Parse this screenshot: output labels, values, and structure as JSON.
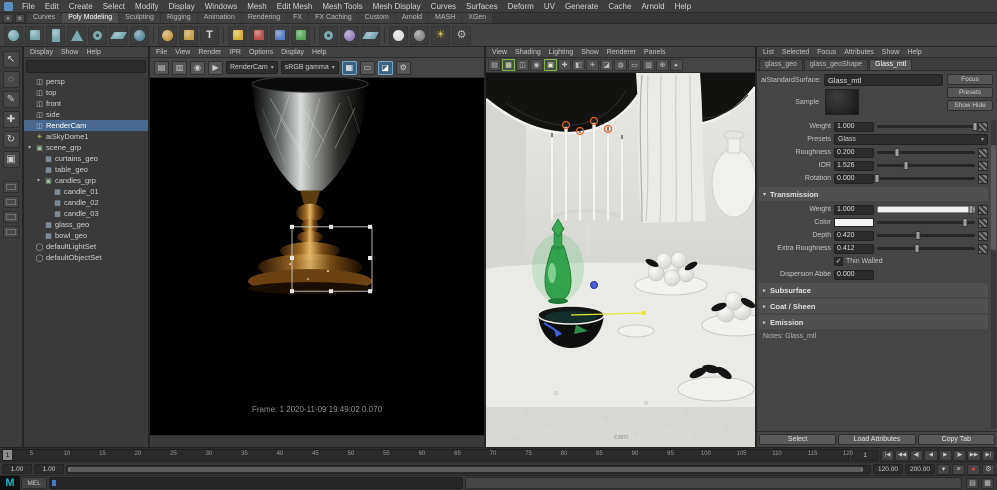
{
  "menu_bar": {
    "items": [
      "File",
      "Edit",
      "Create",
      "Select",
      "Modify",
      "Display",
      "Windows",
      "Mesh",
      "Edit Mesh",
      "Mesh Tools",
      "Mesh Display",
      "Curves",
      "Surfaces",
      "Deform",
      "UV",
      "Generate",
      "Cache",
      "Arnold",
      "Help"
    ]
  },
  "shelf": {
    "tabs": [
      "Curves",
      "Poly Modeling",
      "Sculpting",
      "Rigging",
      "Animation",
      "Rendering",
      "FX",
      "FX Caching",
      "Custom",
      "Arnold",
      "MASH",
      "XGen"
    ],
    "active_tab": "Poly Modeling",
    "icons": [
      {
        "name": "poly-sphere",
        "shape": "circle",
        "color": "#79aab2"
      },
      {
        "name": "poly-cube",
        "shape": "square",
        "color": "#79aab2"
      },
      {
        "name": "poly-cylinder",
        "shape": "rect",
        "color": "#79aab2"
      },
      {
        "name": "poly-cone",
        "shape": "triangle",
        "color": "#79aab2"
      },
      {
        "name": "poly-torus",
        "shape": "ring",
        "color": "#79aab2"
      },
      {
        "name": "poly-plane",
        "shape": "plane",
        "color": "#79aab2"
      },
      {
        "name": "poly-disc",
        "shape": "circle",
        "color": "#5d8fa0"
      },
      {
        "name": "sep1",
        "shape": "sep"
      },
      {
        "name": "nurbs-sphere",
        "shape": "circle",
        "color": "#c9a04e"
      },
      {
        "name": "nurbs-cube",
        "shape": "square",
        "color": "#c9a04e"
      },
      {
        "name": "text-tool",
        "shape": "letter",
        "label": "T",
        "color": "#d8d8d8"
      },
      {
        "name": "sep2",
        "shape": "sep"
      },
      {
        "name": "quad-draw",
        "shape": "square",
        "color": "#d8b23e"
      },
      {
        "name": "multi-cut",
        "shape": "square",
        "color": "#b8524a"
      },
      {
        "name": "target-weld",
        "shape": "square",
        "color": "#5a7fc0"
      },
      {
        "name": "bridge",
        "shape": "square",
        "color": "#58a858"
      },
      {
        "name": "sep3",
        "shape": "sep"
      },
      {
        "name": "booleans",
        "shape": "ring",
        "color": "#79aab2"
      },
      {
        "name": "smooth",
        "shape": "circle",
        "color": "#9a86c0"
      },
      {
        "name": "mirror",
        "shape": "plane",
        "color": "#79aab2"
      },
      {
        "name": "sep4",
        "shape": "sep"
      },
      {
        "name": "arnold-render",
        "shape": "circle",
        "color": "#e0e0e0"
      },
      {
        "name": "arnold-ipr",
        "shape": "circle",
        "color": "#8a8a8a"
      },
      {
        "name": "skydome-light",
        "shape": "glyph",
        "glyph": "☀",
        "color": "#d8c050"
      },
      {
        "name": "render-settings",
        "shape": "glyph",
        "glyph": "⚙",
        "color": "#bbbbbb"
      }
    ]
  },
  "toolbox": {
    "tools": [
      {
        "name": "select-tool",
        "glyph": "↖"
      },
      {
        "name": "lasso-tool",
        "glyph": "◌"
      },
      {
        "name": "paint-select-tool",
        "glyph": "✎"
      },
      {
        "name": "move-tool",
        "glyph": "✚"
      },
      {
        "name": "rotate-tool",
        "glyph": "↻"
      },
      {
        "name": "scale-tool",
        "glyph": "▣"
      }
    ],
    "layouts": [
      {
        "name": "layout-single"
      },
      {
        "name": "layout-four"
      },
      {
        "name": "layout-two"
      },
      {
        "name": "layout-outliner"
      }
    ]
  },
  "outliner": {
    "menus": [
      "Display",
      "Show",
      "Help"
    ],
    "search_placeholder": "",
    "items": [
      {
        "label": "persp",
        "icon": "camera",
        "depth": 1
      },
      {
        "label": "top",
        "icon": "camera",
        "depth": 1
      },
      {
        "label": "front",
        "icon": "camera",
        "depth": 1
      },
      {
        "label": "side",
        "icon": "camera",
        "depth": 1
      },
      {
        "label": "RenderCam",
        "icon": "camera",
        "depth": 1,
        "selected": true
      },
      {
        "label": "aiSkyDome1",
        "icon": "light",
        "depth": 1
      },
      {
        "label": "scene_grp",
        "icon": "group",
        "depth": 1,
        "expanded": true
      },
      {
        "label": "curtains_geo",
        "icon": "mesh",
        "depth": 2
      },
      {
        "label": "table_geo",
        "icon": "mesh",
        "depth": 2
      },
      {
        "label": "candles_grp",
        "icon": "group",
        "depth": 2,
        "expanded": true
      },
      {
        "label": "candle_01",
        "icon": "mesh",
        "depth": 3
      },
      {
        "label": "candle_02",
        "icon": "mesh",
        "depth": 3
      },
      {
        "label": "candle_03",
        "icon": "mesh",
        "depth": 3
      },
      {
        "label": "glass_geo",
        "icon": "mesh",
        "depth": 2
      },
      {
        "label": "bowl_geo",
        "icon": "mesh",
        "depth": 2
      },
      {
        "label": "defaultLightSet",
        "icon": "set",
        "depth": 1
      },
      {
        "label": "defaultObjectSet",
        "icon": "set",
        "depth": 1
      }
    ]
  },
  "render_view": {
    "menus": [
      "File",
      "View",
      "Render",
      "IPR",
      "Options",
      "Display",
      "Help"
    ],
    "toolbar": {
      "buttons_left": [
        {
          "name": "snapshot-button",
          "glyph": "▤"
        },
        {
          "name": "keep-image-button",
          "glyph": "▥"
        },
        {
          "name": "render-button",
          "glyph": "◉"
        },
        {
          "name": "ipr-button",
          "glyph": "▶"
        }
      ],
      "camera_value": "RenderCam",
      "display_value": "sRGB gamma",
      "buttons_right": [
        {
          "name": "aov-beauty-toggle",
          "glyph": "▦",
          "active": true
        },
        {
          "name": "region-toggle",
          "glyph": "▭",
          "active": false
        },
        {
          "name": "snapshot-compare-toggle",
          "glyph": "◪",
          "active": true
        },
        {
          "name": "render-options-button",
          "glyph": "⚙",
          "active": false
        }
      ]
    },
    "footer": "Frame: 1   2020-11-09 19:49:02   0.070"
  },
  "viewport": {
    "menus": [
      "View",
      "Shading",
      "Lighting",
      "Show",
      "Renderer",
      "Panels"
    ],
    "toolbar_icons": [
      {
        "name": "select-hierarchy-icon",
        "glyph": "▤",
        "active": false
      },
      {
        "name": "grid-snap-icon",
        "glyph": "▦",
        "active": true
      },
      {
        "name": "curve-snap-icon",
        "glyph": "◫",
        "active": false
      },
      {
        "name": "point-snap-icon",
        "glyph": "◉",
        "active": false
      },
      {
        "name": "shaded-mode-icon",
        "glyph": "▣",
        "active": true
      },
      {
        "name": "wireframe-mode-icon",
        "glyph": "✚",
        "active": false
      },
      {
        "name": "textured-mode-icon",
        "glyph": "◧",
        "active": false
      },
      {
        "name": "lighting-toggle-icon",
        "glyph": "☀",
        "active": false
      },
      {
        "name": "shadows-toggle-icon",
        "glyph": "◪",
        "active": false
      },
      {
        "name": "ao-toggle-icon",
        "glyph": "◍",
        "active": false
      },
      {
        "name": "isolate-select-icon",
        "glyph": "▭",
        "active": false
      },
      {
        "name": "xray-toggle-icon",
        "glyph": "▥",
        "active": false
      },
      {
        "name": "camera-attrs-icon",
        "glyph": "⊕",
        "active": false
      },
      {
        "name": "more-tools-icon",
        "glyph": "▸",
        "active": false
      }
    ],
    "camera_label": "cam"
  },
  "attribute_editor": {
    "menus": [
      "List",
      "Selected",
      "Focus",
      "Attributes",
      "Show",
      "Help"
    ],
    "tabs": [
      {
        "label": "glass_geo",
        "active": false
      },
      {
        "label": "glass_geoShape",
        "active": false
      },
      {
        "label": "Glass_mtl",
        "active": true
      }
    ],
    "node_type_label": "aiStandardSurface:",
    "node_name": "Glass_mtl",
    "header_buttons": [
      "Focus",
      "Presets",
      "Show Hide"
    ],
    "sample_label": "Sample",
    "rows": [
      {
        "type": "slider",
        "label": "Weight",
        "value": "1.000",
        "fraction": 1
      },
      {
        "type": "dropdown",
        "label": "Presets",
        "value": "Glass"
      },
      {
        "type": "slider",
        "label": "Roughness",
        "value": "0.200",
        "fraction": 0.2
      },
      {
        "type": "slider",
        "label": "IOR",
        "value": "1.526",
        "fraction": 0.3
      },
      {
        "type": "slider",
        "label": "Rotation",
        "value": "0.000",
        "fraction": 0
      },
      {
        "type": "section",
        "label": "Transmission",
        "expanded": true
      },
      {
        "type": "slider",
        "label": "Weight",
        "value": "1.000",
        "fraction": 0.97,
        "fill": "#f0f0f0"
      },
      {
        "type": "color",
        "label": "Color",
        "swatch": "#f5f5f5",
        "fraction": 0.9
      },
      {
        "type": "slider",
        "label": "Depth",
        "value": "0.420",
        "fraction": 0.42
      },
      {
        "type": "slider",
        "label": "Extra Roughness",
        "value": "0.412",
        "fraction": 0.41
      },
      {
        "type": "checkbox",
        "label": "Thin Walled",
        "checked": true
      },
      {
        "type": "field",
        "label": "Dispersion Abbe",
        "value": "0.000"
      },
      {
        "type": "section",
        "label": "Subsurface",
        "expanded": false
      },
      {
        "type": "section",
        "label": "Coat / Sheen",
        "expanded": false
      },
      {
        "type": "section",
        "label": "Emission",
        "expanded": false
      },
      {
        "type": "notes",
        "label": "Notes: Glass_mtl"
      }
    ],
    "footer_buttons": [
      "Select",
      "Load Attributes",
      "Copy Tab"
    ]
  },
  "timeline": {
    "start": 1,
    "end": 120,
    "label_step": 5,
    "current": 1,
    "current_display": "1",
    "playback_buttons": [
      {
        "name": "go-to-start-button",
        "glyph": "|◀"
      },
      {
        "name": "step-back-frame-button",
        "glyph": "◀◀"
      },
      {
        "name": "step-back-key-button",
        "glyph": "◀|"
      },
      {
        "name": "play-backwards-button",
        "glyph": "◀"
      },
      {
        "name": "play-forwards-button",
        "glyph": "▶"
      },
      {
        "name": "step-forward-key-button",
        "glyph": "|▶"
      },
      {
        "name": "step-forward-frame-button",
        "glyph": "▶▶"
      },
      {
        "name": "go-to-end-button",
        "glyph": "▶|"
      }
    ]
  },
  "range_slider": {
    "playback_start": "1.00",
    "anim_start": "1.00",
    "anim_end": "120.00",
    "playback_end": "200.00",
    "right_buttons": [
      {
        "name": "character-set-menu",
        "glyph": "▾",
        "color": ""
      },
      {
        "name": "anim-layer-button",
        "glyph": "≡",
        "color": ""
      },
      {
        "name": "auto-key-toggle",
        "glyph": "●",
        "color": "#d04040"
      },
      {
        "name": "animation-prefs-button",
        "glyph": "⚙",
        "color": ""
      }
    ]
  },
  "command_line": {
    "logo_letter": "M",
    "mode_label": "MEL",
    "input_value": "",
    "result_value": "",
    "right_icons": [
      {
        "name": "script-editor-icon",
        "glyph": "▤"
      },
      {
        "name": "output-window-icon",
        "glyph": "▦"
      }
    ]
  },
  "colors": {
    "selection_blue": "#49688f",
    "active_green": "#7ab648",
    "active_blue": "#3f637e",
    "autokey_red": "#d04040",
    "logo_teal": "#18b3c4"
  }
}
